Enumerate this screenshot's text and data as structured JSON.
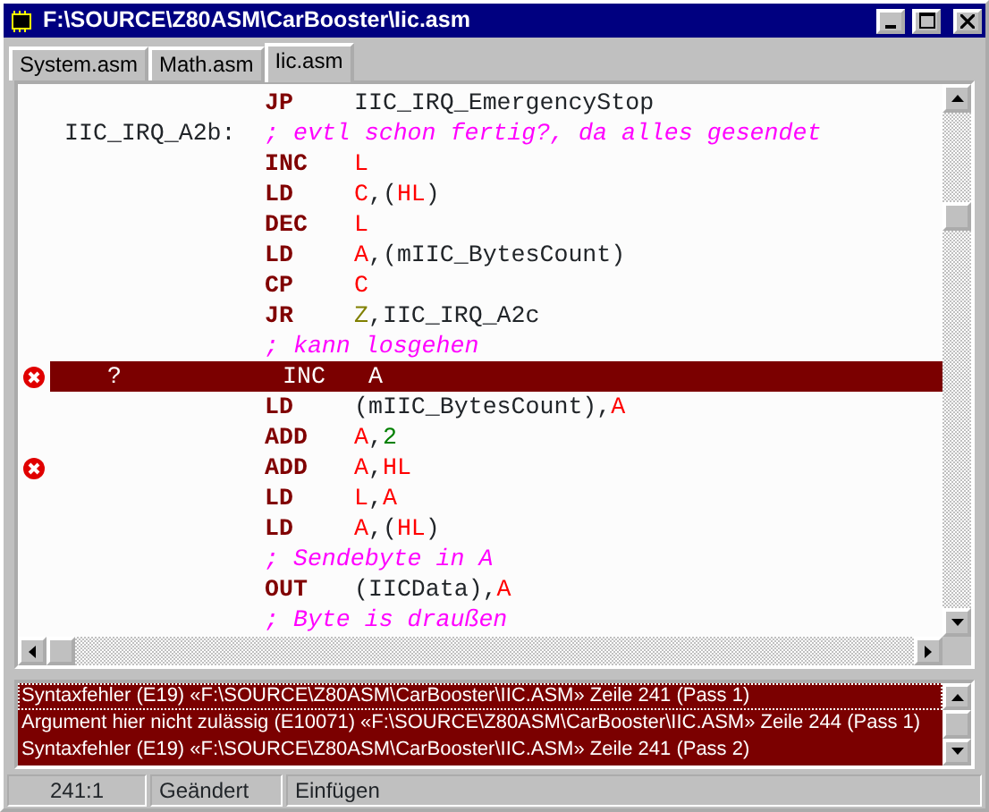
{
  "window": {
    "title": "F:\\SOURCE\\Z80ASM\\CarBooster\\Iic.asm"
  },
  "tabs": [
    {
      "label": "System.asm",
      "selected": false
    },
    {
      "label": "Math.asm",
      "selected": false
    },
    {
      "label": "Iic.asm",
      "selected": true
    }
  ],
  "code_lines": [
    {
      "error": false,
      "selected": false,
      "mnemonic": "JP",
      "operands": [
        {
          "kind": "plain",
          "text": "IIC_IRQ_EmergencyStop"
        }
      ]
    },
    {
      "label": "IIC_IRQ_A2b:",
      "error": false,
      "selected": false,
      "operands": [
        {
          "kind": "comment",
          "text": "; evtl schon fertig?, da alles gesendet"
        }
      ]
    },
    {
      "error": false,
      "selected": false,
      "mnemonic": "INC",
      "operands": [
        {
          "kind": "register",
          "text": "L"
        }
      ]
    },
    {
      "error": false,
      "selected": false,
      "mnemonic": "LD",
      "operands": [
        {
          "kind": "register",
          "text": "C"
        },
        {
          "kind": "plain",
          "text": ",("
        },
        {
          "kind": "register",
          "text": "HL"
        },
        {
          "kind": "plain",
          "text": ")"
        }
      ]
    },
    {
      "error": false,
      "selected": false,
      "mnemonic": "DEC",
      "operands": [
        {
          "kind": "register",
          "text": "L"
        }
      ]
    },
    {
      "error": false,
      "selected": false,
      "mnemonic": "LD",
      "operands": [
        {
          "kind": "register",
          "text": "A"
        },
        {
          "kind": "plain",
          "text": ",(mIIC_BytesCount)"
        }
      ]
    },
    {
      "error": false,
      "selected": false,
      "mnemonic": "CP",
      "operands": [
        {
          "kind": "register",
          "text": "C"
        }
      ]
    },
    {
      "error": false,
      "selected": false,
      "mnemonic": "JR",
      "operands": [
        {
          "kind": "condition",
          "text": "Z"
        },
        {
          "kind": "plain",
          "text": ",IIC_IRQ_A2c"
        }
      ]
    },
    {
      "error": false,
      "selected": false,
      "operands": [
        {
          "kind": "comment",
          "text": "; kann losgehen"
        }
      ]
    },
    {
      "label": "?",
      "error": true,
      "selected": true,
      "mnemonic": "INC",
      "operands": [
        {
          "kind": "register",
          "text": "A"
        }
      ]
    },
    {
      "error": false,
      "selected": false,
      "mnemonic": "LD",
      "operands": [
        {
          "kind": "plain",
          "text": "(mIIC_BytesCount),"
        },
        {
          "kind": "register",
          "text": "A"
        }
      ]
    },
    {
      "error": false,
      "selected": false,
      "mnemonic": "ADD",
      "operands": [
        {
          "kind": "register",
          "text": "A"
        },
        {
          "kind": "plain",
          "text": ","
        },
        {
          "kind": "number",
          "text": "2"
        }
      ]
    },
    {
      "error": true,
      "selected": false,
      "mnemonic": "ADD",
      "operands": [
        {
          "kind": "register",
          "text": "A"
        },
        {
          "kind": "plain",
          "text": ","
        },
        {
          "kind": "register",
          "text": "HL"
        }
      ]
    },
    {
      "error": false,
      "selected": false,
      "mnemonic": "LD",
      "operands": [
        {
          "kind": "register",
          "text": "L"
        },
        {
          "kind": "plain",
          "text": ","
        },
        {
          "kind": "register",
          "text": "A"
        }
      ]
    },
    {
      "error": false,
      "selected": false,
      "mnemonic": "LD",
      "operands": [
        {
          "kind": "register",
          "text": "A"
        },
        {
          "kind": "plain",
          "text": ",("
        },
        {
          "kind": "register",
          "text": "HL"
        },
        {
          "kind": "plain",
          "text": ")"
        }
      ]
    },
    {
      "error": false,
      "selected": false,
      "operands": [
        {
          "kind": "comment",
          "text": "; Sendebyte in A"
        }
      ]
    },
    {
      "error": false,
      "selected": false,
      "mnemonic": "OUT",
      "operands": [
        {
          "kind": "plain",
          "text": "(IICData),"
        },
        {
          "kind": "register",
          "text": "A"
        }
      ]
    },
    {
      "error": false,
      "selected": false,
      "operands": [
        {
          "kind": "comment",
          "text": "; Byte is draußen"
        }
      ]
    }
  ],
  "messages": [
    {
      "text": "Syntaxfehler (E19) «F:\\SOURCE\\Z80ASM\\CarBooster\\IIC.ASM» Zeile 241 (Pass 1)",
      "selected": true
    },
    {
      "text": "Argument hier nicht zulässig (E10071) «F:\\SOURCE\\Z80ASM\\CarBooster\\IIC.ASM» Zeile 244 (Pass 1)",
      "selected": false
    },
    {
      "text": "Syntaxfehler (E19) «F:\\SOURCE\\Z80ASM\\CarBooster\\IIC.ASM» Zeile 241 (Pass 2)",
      "selected": false
    }
  ],
  "status_bar": {
    "position": "241:1",
    "modified": "Geändert",
    "mode": "Einfügen"
  }
}
